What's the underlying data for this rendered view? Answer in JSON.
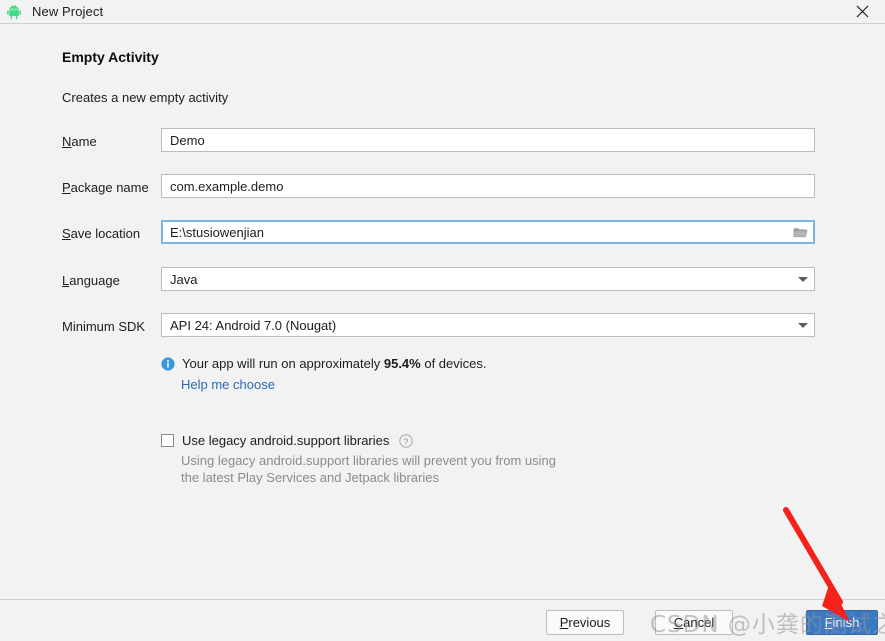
{
  "window": {
    "title": "New Project",
    "app_icon": "android-robot-icon",
    "close_icon": "close-icon"
  },
  "wizard": {
    "heading": "Empty Activity",
    "subheading": "Creates a new empty activity"
  },
  "form": {
    "rows": [
      {
        "label_prefix": "",
        "label_mnemonic": "N",
        "label_suffix": "ame",
        "label_full": "Name",
        "value": "Demo",
        "type": "text",
        "focused": false,
        "name": "project-name"
      },
      {
        "label_prefix": "",
        "label_mnemonic": "P",
        "label_suffix": "ackage name",
        "label_full": "Package name",
        "value": "com.example.demo",
        "type": "text",
        "focused": false,
        "name": "package-name"
      },
      {
        "label_prefix": "",
        "label_mnemonic": "S",
        "label_suffix": "ave location",
        "label_full": "Save location",
        "value": "E:\\stusiowenjian",
        "type": "text-browse",
        "focused": true,
        "name": "save-location",
        "browse_icon": "folder-icon"
      },
      {
        "label_prefix": "",
        "label_mnemonic": "L",
        "label_suffix": "anguage",
        "label_full": "Language",
        "value": "Java",
        "type": "dropdown",
        "focused": false,
        "name": "language",
        "arrow_icon": "chevron-down-icon"
      },
      {
        "label_prefix": "Minimum SDK",
        "label_mnemonic": "",
        "label_suffix": "",
        "label_full": "Minimum SDK",
        "value": "API 24: Android 7.0 (Nougat)",
        "type": "dropdown",
        "focused": false,
        "name": "minimum-sdk",
        "arrow_icon": "chevron-down-icon"
      }
    ]
  },
  "info": {
    "icon": "info-icon",
    "text_before": "Your app will run on approximately ",
    "percent": "95.4%",
    "text_after": " of devices.",
    "link": "Help me choose"
  },
  "legacy": {
    "icon": "help-circle-icon",
    "checkbox_label": "Use legacy android.support libraries",
    "checked": false,
    "description_line1": "Using legacy android.support libraries will prevent you from using",
    "description_line2": "the latest Play Services and Jetpack libraries"
  },
  "footer": {
    "previous": {
      "prefix": "",
      "mnemonic": "P",
      "suffix": "revious",
      "full": "Previous"
    },
    "cancel": {
      "prefix": "",
      "mnemonic": "C",
      "suffix": "ancel",
      "full": "Cancel"
    },
    "finish": {
      "prefix": "",
      "mnemonic": "F",
      "suffix": "inish",
      "full": "Finish"
    }
  },
  "annotations": {
    "watermark": "CSDN @小龚的测试之路",
    "arrow": "red-arrow-pointing-to-finish"
  },
  "colors": {
    "window_bg": "#f2f2f2",
    "field_bg": "#ffffff",
    "focus_border": "#7ab5e8",
    "link": "#2a6ab5",
    "primary_button": "#3c79c4",
    "info_icon": "#3a9ad9",
    "android_green": "#3ddc84",
    "arrow": "#f5221c",
    "muted_text": "#8b8b8b"
  }
}
